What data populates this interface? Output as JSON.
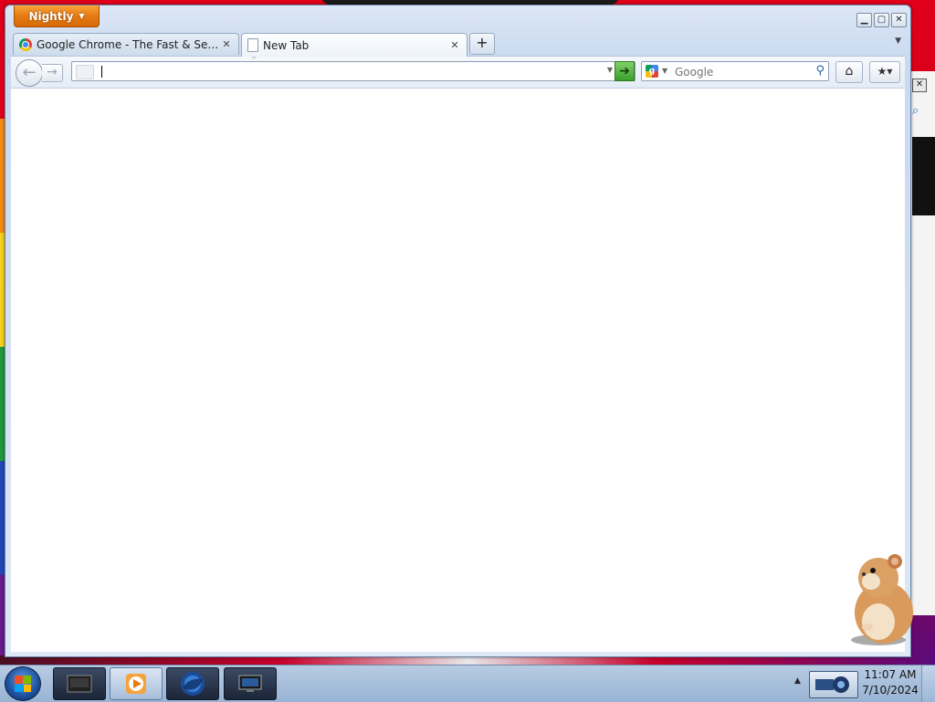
{
  "browser": {
    "app_menu_label": "Nightly",
    "tabs": [
      {
        "label": "Google Chrome - The Fast & Secure ...",
        "icon": "chrome-icon"
      },
      {
        "label": "New Tab",
        "icon": "page-icon",
        "active": true
      }
    ],
    "new_tab_label": "+",
    "url_bar": {
      "value": "",
      "placeholder": ""
    },
    "search": {
      "engine": "Google",
      "placeholder": "Google",
      "value": ""
    },
    "window_controls": [
      "minimize",
      "maximize",
      "close"
    ]
  },
  "taskbar": {
    "clock_time": "11:07 AM",
    "clock_date": "7/10/2024",
    "pinned": [
      "explorer-icon",
      "media-player-icon",
      "firefox-icon",
      "monitor-icon"
    ]
  },
  "colors": {
    "app_button": "#e67a13",
    "go_button": "#3b9f2a",
    "taskbar": "#98b3d3",
    "wallpaper": "#c6001a"
  }
}
